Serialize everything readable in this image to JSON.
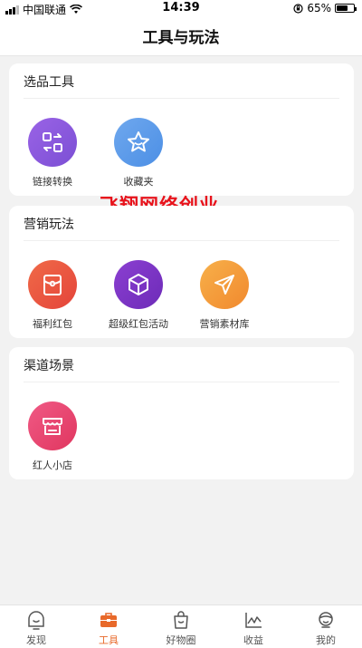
{
  "status_bar": {
    "carrier": "中国联通",
    "time": "14:39",
    "battery_percent": "65%",
    "battery_level": 0.65
  },
  "nav": {
    "title": "工具与玩法"
  },
  "watermark_text": "飞翔网络创业",
  "sections": [
    {
      "title": "选品工具",
      "items": [
        {
          "label": "链接转换",
          "icon": "link-convert-icon",
          "color_from": "#9a63e6",
          "color_to": "#7b4fd4"
        },
        {
          "label": "收藏夹",
          "icon": "star-favorites-icon",
          "color_from": "#6fa8ee",
          "color_to": "#4c8fe5"
        }
      ]
    },
    {
      "title": "营销玩法",
      "items": [
        {
          "label": "福利红包",
          "icon": "red-envelope-icon",
          "color_from": "#f06a48",
          "color_to": "#e4443a"
        },
        {
          "label": "超级红包活动",
          "icon": "cube-box-icon",
          "color_from": "#8b3fd1",
          "color_to": "#6d2bb8"
        },
        {
          "label": "营销素材库",
          "icon": "paper-plane-icon",
          "color_from": "#f7b04a",
          "color_to": "#f1892e"
        }
      ]
    },
    {
      "title": "渠道场景",
      "items": [
        {
          "label": "红人小店",
          "icon": "shop-icon",
          "color_from": "#f05a85",
          "color_to": "#e0365f"
        }
      ]
    }
  ],
  "tabs": [
    {
      "label": "发现",
      "icon": "discover-face-icon",
      "active": false
    },
    {
      "label": "工具",
      "icon": "toolbox-icon",
      "active": true
    },
    {
      "label": "好物圈",
      "icon": "shopping-bag-icon",
      "active": false
    },
    {
      "label": "收益",
      "icon": "earnings-chart-icon",
      "active": false
    },
    {
      "label": "我的",
      "icon": "profile-icon",
      "active": false
    }
  ],
  "colors": {
    "accent": "#e8692a",
    "watermark": "#e8121b"
  }
}
